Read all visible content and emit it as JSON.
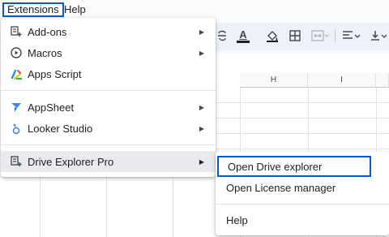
{
  "menubar": {
    "extensions": "Extensions",
    "help": "Help"
  },
  "toolbar": {
    "text_color_glyph": "A"
  },
  "sheet": {
    "columns": [
      "H",
      "I"
    ]
  },
  "extensions_menu": {
    "items": [
      {
        "label": "Add-ons",
        "icon": "addons-icon",
        "has_submenu": true
      },
      {
        "label": "Macros",
        "icon": "macros-icon",
        "has_submenu": true
      },
      {
        "label": "Apps Script",
        "icon": "apps-script-icon",
        "has_submenu": false
      },
      {
        "label": "AppSheet",
        "icon": "appsheet-icon",
        "has_submenu": true
      },
      {
        "label": "Looker Studio",
        "icon": "looker-studio-icon",
        "has_submenu": true
      },
      {
        "label": "Drive Explorer Pro",
        "icon": "addon-extension-icon",
        "has_submenu": true
      }
    ]
  },
  "submenu": {
    "items": [
      {
        "label": "Open Drive explorer"
      },
      {
        "label": "Open License manager"
      },
      {
        "label": "Help"
      }
    ]
  },
  "colors": {
    "accent": "#0b57d0",
    "hover": "#e8eaed"
  }
}
